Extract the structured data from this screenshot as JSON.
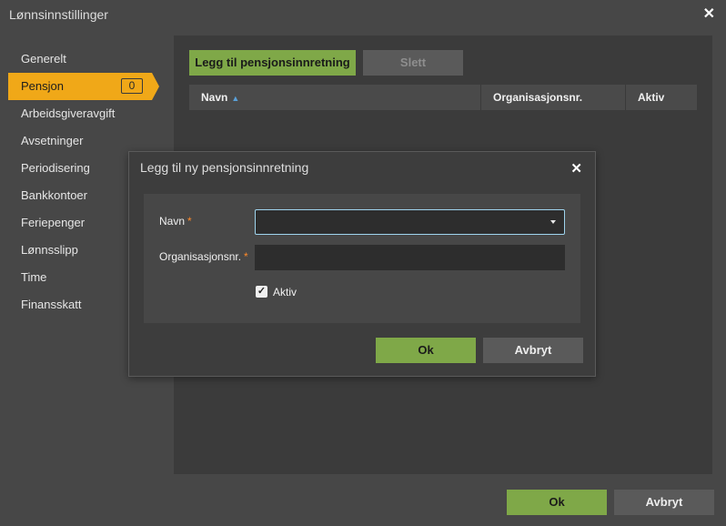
{
  "window": {
    "title": "Lønnsinnstillinger",
    "close_label": "✕"
  },
  "sidebar": {
    "items": [
      {
        "label": "Generelt"
      },
      {
        "label": "Pensjon",
        "badge": "0"
      },
      {
        "label": "Arbeidsgiveravgift"
      },
      {
        "label": "Avsetninger"
      },
      {
        "label": "Periodisering"
      },
      {
        "label": "Bankkontoer"
      },
      {
        "label": "Feriepenger"
      },
      {
        "label": "Lønnsslipp"
      },
      {
        "label": "Time"
      },
      {
        "label": "Finansskatt"
      }
    ],
    "active_index": 1
  },
  "toolbar": {
    "add_label": "Legg til pensjonsinnretning",
    "delete_label": "Slett"
  },
  "grid": {
    "columns": [
      {
        "label": "Navn",
        "sort": "ascending"
      },
      {
        "label": "Organisasjonsnr."
      },
      {
        "label": "Aktiv"
      }
    ],
    "rows": []
  },
  "dialog": {
    "title": "Legg til ny pensjonsinnretning",
    "close_label": "✕",
    "fields": {
      "navn_label": "Navn",
      "navn_value": "",
      "org_label": "Organisasjonsnr.",
      "org_value": "",
      "required_mark": "*",
      "aktiv_label": "Aktiv",
      "aktiv_checked": true,
      "check_glyph": "✓"
    },
    "ok_label": "Ok",
    "cancel_label": "Avbryt"
  },
  "footer": {
    "ok_label": "Ok",
    "cancel_label": "Avbryt"
  },
  "colors": {
    "accent": "#f0a818",
    "primary_button": "#7fa848",
    "required": "#ff8a2a",
    "focus": "#9fd4ee"
  }
}
